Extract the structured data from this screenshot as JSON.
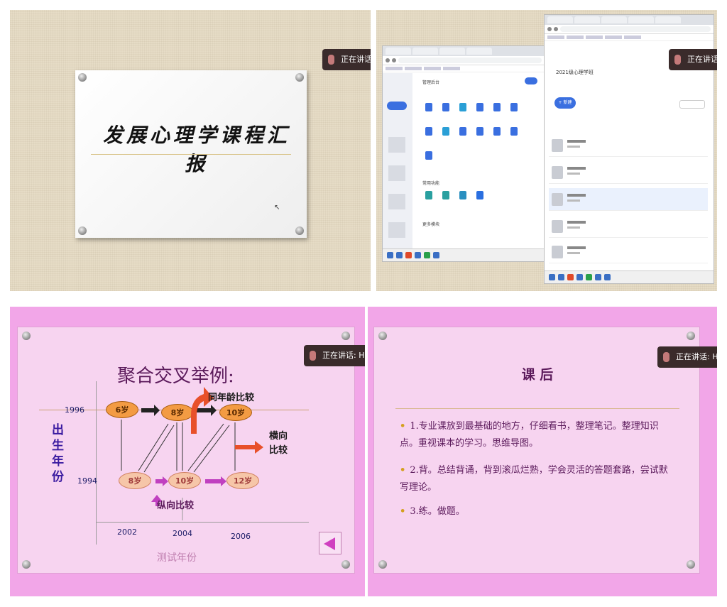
{
  "speaking_indicator": {
    "label": "正在讲话: H",
    "label_short": "正在讲话: Hu"
  },
  "panel1": {
    "slide_title": "发展心理学课程汇报"
  },
  "panel2": {
    "app_heading": "管理后台",
    "app_subheading": "常用功能",
    "section_other": "更多模块",
    "right_title": "2021级心理学班",
    "right_button": "+ 新建",
    "list_items": [
      "01课程",
      "02课程",
      "03课程",
      "04课程",
      "05课程"
    ]
  },
  "panel3": {
    "title": "聚合交叉举例:",
    "label_same_age": "同年龄比较",
    "label_horizontal": "横向比较",
    "label_vertical": "纵向比较",
    "y_axis_label": "出生年份",
    "x_axis_label": "测试年份",
    "row_years": [
      "1996",
      "1994"
    ],
    "col_years": [
      "2002",
      "2004",
      "2006"
    ],
    "top_nodes": [
      "6岁",
      "8岁",
      "10岁"
    ],
    "bottom_nodes": [
      "8岁",
      "10岁",
      "12岁"
    ]
  },
  "panel4": {
    "title": "课 后",
    "bullets": [
      "1.专业课放到最基础的地方，仔细看书，整理笔记。整理知识点。重视课本的学习。思维导图。",
      "2.背。总结背诵，背到滚瓜烂熟，学会灵活的答题套路，尝试默写理论。",
      "3.练。做题。"
    ]
  },
  "colors": {
    "pink_overlay": "#f2a6e8",
    "speaking_bg": "#3a2b2b",
    "title_purple": "#5b1a5b",
    "node_orange": "#f39b43",
    "arrow_red": "#e8502a"
  }
}
